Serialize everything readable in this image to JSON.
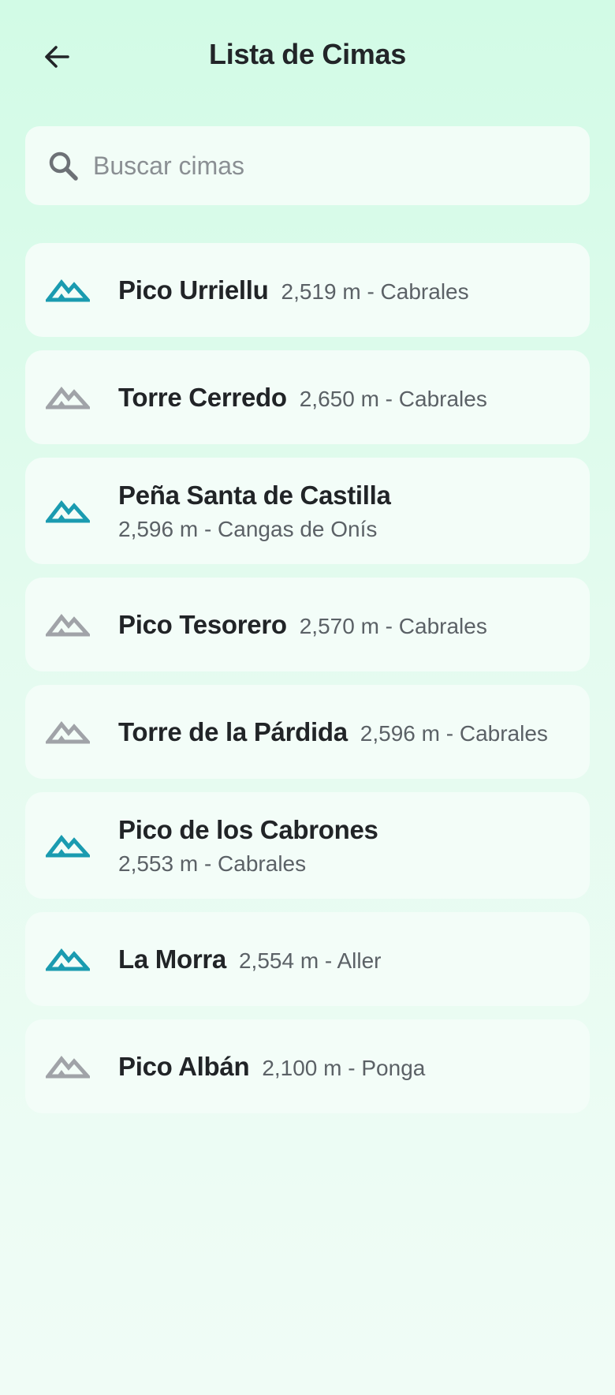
{
  "header": {
    "title": "Lista de Cimas",
    "back_icon": "arrow-left-icon"
  },
  "search": {
    "placeholder": "Buscar cimas",
    "value": "",
    "icon": "search-icon"
  },
  "colors": {
    "accent": "#1a9bb0",
    "inactive": "#a0a3a8",
    "card": "#f3fdf8"
  },
  "peaks": [
    {
      "name": "Pico Urriellu",
      "detail": "2,519 m - Cabrales",
      "highlighted": true
    },
    {
      "name": "Torre Cerredo",
      "detail": "2,650 m - Cabrales",
      "highlighted": false
    },
    {
      "name": "Peña Santa de Castilla",
      "detail": "2,596 m - Cangas de Onís",
      "highlighted": true
    },
    {
      "name": "Pico Tesorero",
      "detail": "2,570 m - Cabrales",
      "highlighted": false
    },
    {
      "name": "Torre de la Párdida",
      "detail": "2,596 m - Cabrales",
      "highlighted": false
    },
    {
      "name": "Pico de los Cabrones",
      "detail": "2,553 m - Cabrales",
      "highlighted": true
    },
    {
      "name": "La Morra",
      "detail": "2,554 m - Aller",
      "highlighted": true
    },
    {
      "name": "Pico Albán",
      "detail": "2,100 m - Ponga",
      "highlighted": false
    }
  ]
}
